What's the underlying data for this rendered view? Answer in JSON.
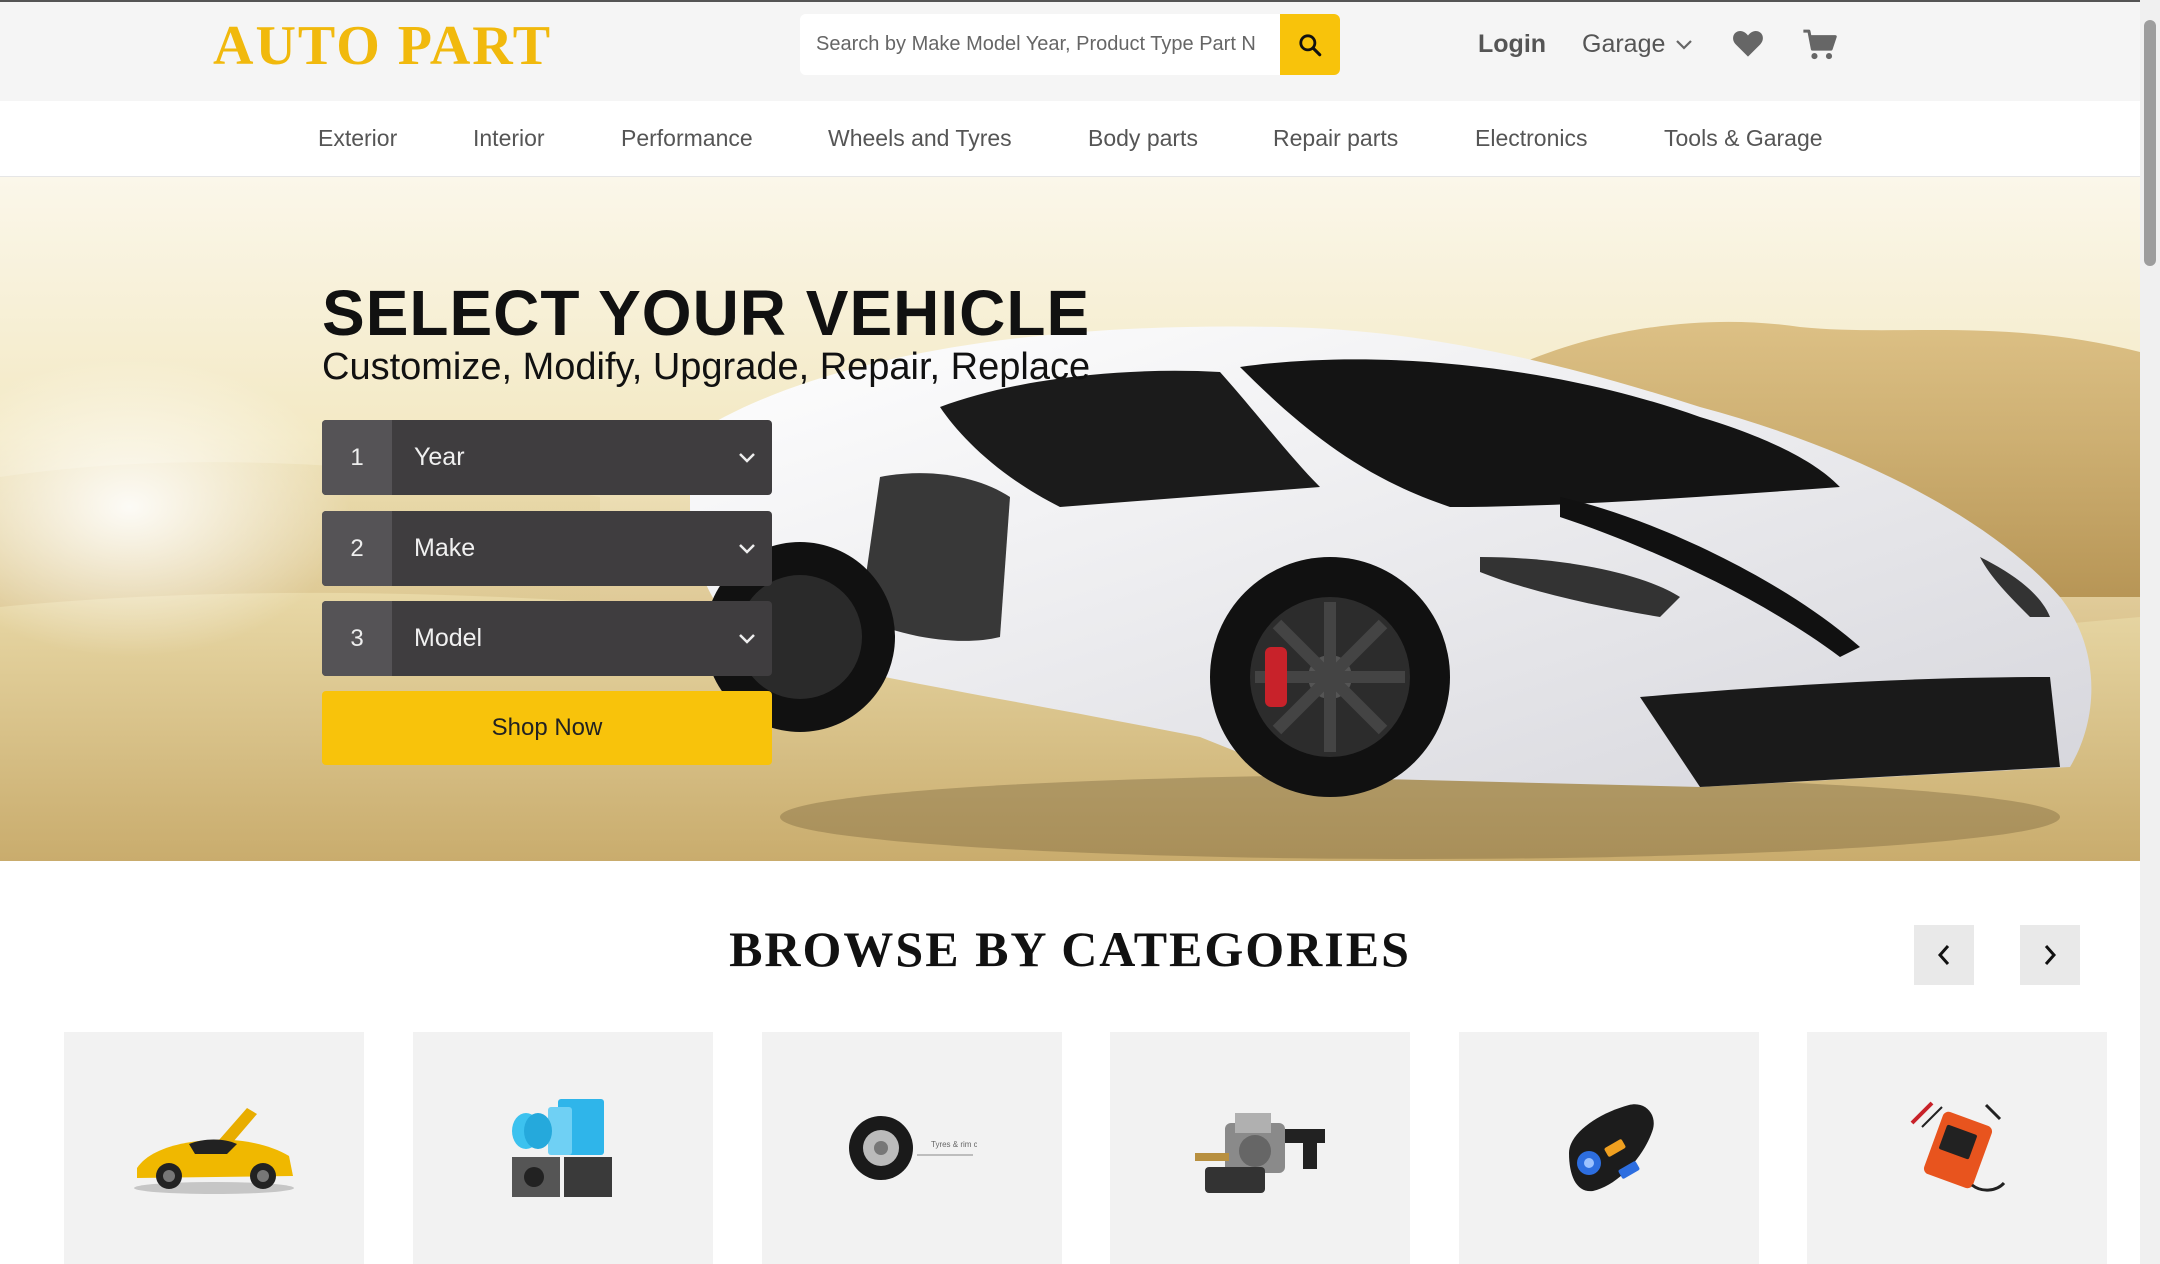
{
  "header": {
    "logo": "AUTO PART",
    "search": {
      "placeholder": "Search by Make Model Year, Product Type Part N",
      "value": ""
    },
    "login_label": "Login",
    "garage_label": "Garage",
    "icons": [
      "search-icon",
      "chevron-down-icon",
      "heart-icon",
      "cart-icon"
    ]
  },
  "nav": {
    "items": [
      {
        "label": "Exterior"
      },
      {
        "label": "Interior"
      },
      {
        "label": "Performance"
      },
      {
        "label": "Wheels and Tyres"
      },
      {
        "label": "Body parts"
      },
      {
        "label": "Repair parts"
      },
      {
        "label": "Electronics"
      },
      {
        "label": "Tools & Garage"
      }
    ]
  },
  "hero": {
    "title": "SELECT YOUR VEHICLE",
    "subtitle": "Customize, Modify, Upgrade, Repair, Replace",
    "selects": [
      {
        "number": "1",
        "label": "Year"
      },
      {
        "number": "2",
        "label": "Make"
      },
      {
        "number": "3",
        "label": "Model"
      }
    ],
    "cta_label": "Shop Now"
  },
  "categories": {
    "title": "BROWSE BY CATEGORIES",
    "cards": [
      {
        "image": "yellow-sports-car"
      },
      {
        "image": "blue-mirror-film"
      },
      {
        "image": "tyre",
        "caption": "Tyres & rim care"
      },
      {
        "image": "carburetor"
      },
      {
        "image": "usb-car-charger"
      },
      {
        "image": "battery-charger"
      }
    ]
  },
  "colors": {
    "accent": "#f8c30b",
    "logo": "#f1b90d",
    "select_bg": "#3f3d3f",
    "card_bg": "#f2f2f2"
  }
}
